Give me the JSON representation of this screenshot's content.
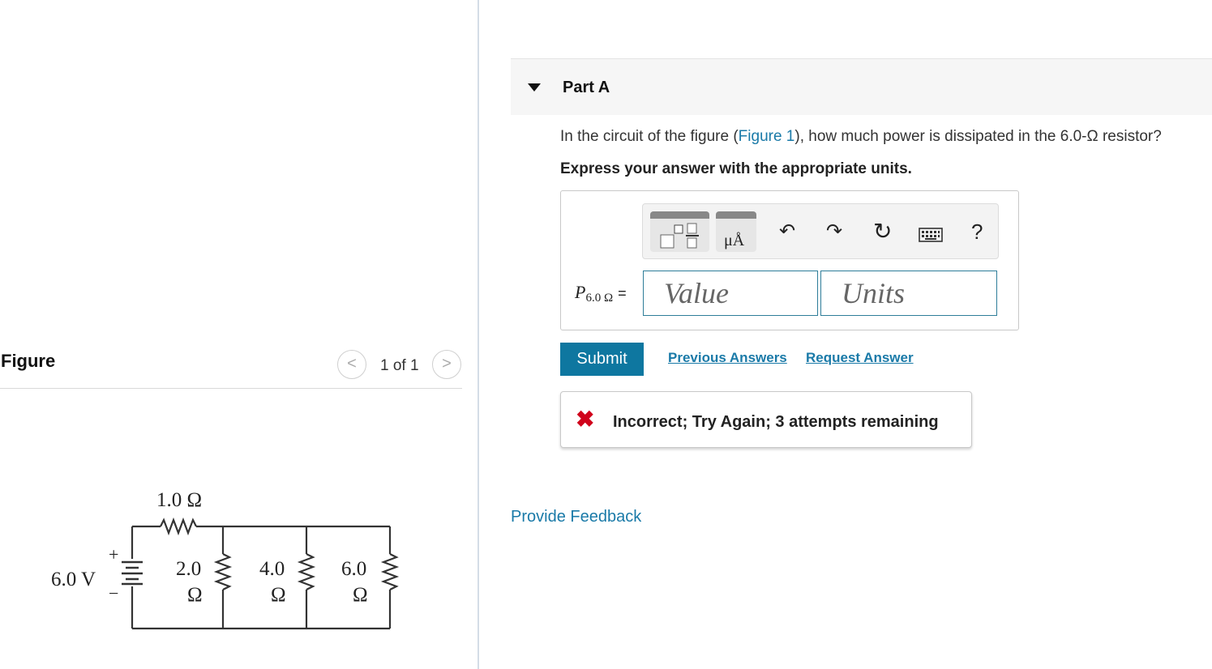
{
  "figure": {
    "heading": "Figure",
    "pager": {
      "prev": "<",
      "count": "1 of 1",
      "next": ">"
    },
    "circuit": {
      "source_voltage": "6.0 V",
      "source_plus": "+",
      "source_minus": "−",
      "series_resistor": "1.0 Ω",
      "resistors": [
        {
          "value": "2.0",
          "unit": "Ω"
        },
        {
          "value": "4.0",
          "unit": "Ω"
        },
        {
          "value": "6.0",
          "unit": "Ω"
        }
      ]
    }
  },
  "part": {
    "title": "Part A",
    "question_before_link": "In the circuit of the figure (",
    "question_link": "Figure 1",
    "question_after_link": "), how much power is dissipated in the 6.0-Ω resistor?",
    "instruction": "Express your answer with the appropriate units."
  },
  "answer": {
    "toolbar": {
      "templates_icon": "templates-icon",
      "units_label": "μÅ",
      "undo_glyph": "↶",
      "redo_glyph": "↷",
      "reset_glyph": "↻",
      "keyboard_glyph": "⌨",
      "help_glyph": "?"
    },
    "label_main": "P",
    "label_sub": "6.0 Ω",
    "label_eq": "=",
    "value_placeholder": "Value",
    "units_placeholder": "Units"
  },
  "actions": {
    "submit": "Submit",
    "previous_answers": "Previous Answers",
    "request_answer": "Request Answer"
  },
  "feedback": {
    "icon_glyph": "✖",
    "text": "Incorrect; Try Again; 3 attempts remaining"
  },
  "provide_feedback": "Provide Feedback",
  "colors": {
    "accent": "#0e77a0",
    "link": "#1a7aa8",
    "error": "#d0021b"
  }
}
